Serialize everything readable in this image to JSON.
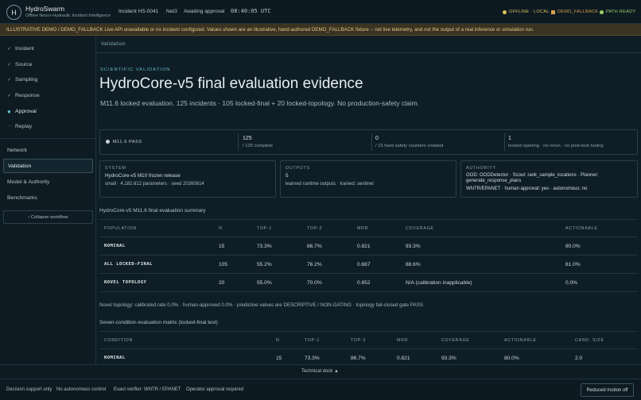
{
  "app": {
    "logo_letter": "H",
    "name": "HydroSwarm",
    "subtitle": "Offline Neuro-Hydraulic Incident Intelligence"
  },
  "topbar": {
    "incident": "Incident HS-0041",
    "network": "Net3",
    "state": "Awaiting approval",
    "clock": "08:40:05 UTC",
    "statuses": [
      {
        "label": "OFFLINE · LOCAL",
        "color": "#d9c25a"
      },
      {
        "label": "DEMO_FALLBACK",
        "color": "#d9a04a"
      },
      {
        "label": "PATH READY",
        "color": "#9fcf6a"
      }
    ]
  },
  "banner": "ILLUSTRATIVE DEMO / DEMO_FALLBACK  Live API unavailable or no incident configured. Values shown are an illustrative, hand-authored DEMO_FALLBACK fixture -- not live telemetry, and not the output of a real inference or simulation run.",
  "sidebar": {
    "workflow": [
      {
        "label": "Incident",
        "icon": "check-icon",
        "glyph": "✓"
      },
      {
        "label": "Source",
        "icon": "check-icon",
        "glyph": "✓"
      },
      {
        "label": "Sampling",
        "icon": "check-icon",
        "glyph": "✓"
      },
      {
        "label": "Response",
        "icon": "check-icon",
        "glyph": "✓"
      },
      {
        "label": "Approval",
        "icon": "current-dot-icon",
        "glyph": "●"
      },
      {
        "label": "Replay",
        "icon": "pending-dots-icon",
        "glyph": "···"
      }
    ],
    "nav": [
      "Network",
      "Validation",
      "Model & Authority",
      "Benchmarks"
    ],
    "active": "Validation",
    "collapse_label": "‹ Collapse workflow"
  },
  "main": {
    "breadcrumb": "Validation",
    "eyebrow": "SCIENTIFIC VALIDATION",
    "title": "HydroCore-v5 final evaluation evidence",
    "lead": "M11.6 locked evaluation. 125 incidents · 105 locked-final + 20 locked-topology. No production-safety claim.",
    "kpis": {
      "pass_label": "M11.6 PASS",
      "pass_color": "#c8d3d7",
      "items": [
        {
          "value": "125",
          "label": "/ 125 complete"
        },
        {
          "value": "0",
          "label": "/ 15 hard safety counters violated"
        },
        {
          "value": "1",
          "label": "locked opening · no rerun · no post-lock tuning"
        }
      ]
    },
    "cards": {
      "system": {
        "heading": "SYSTEM",
        "line1": "HydroCore-v5 M10 frozen release",
        "line2": "small · 4,182,612 parameters · seed 20260814"
      },
      "outputs": {
        "heading": "OUTPUTS",
        "line1": "5",
        "line2": "learned runtime outputs · trained: sentinel"
      },
      "authority": {
        "heading": "AUTHORITY",
        "line1": "OOD: OODDetector · Scout: rank_sample_locations · Planner:",
        "line1b": "generate_response_plans",
        "line2": "WNTR/EPANET · human approval: yes · autonomous: no"
      }
    },
    "summary": {
      "title": "HydroCore-v5 M11.6 final evaluation summary",
      "headers": [
        "POPULATION",
        "N",
        "TOP-1",
        "TOP-3",
        "MRR",
        "COVERAGE",
        "ACTIONABLE"
      ],
      "rows": [
        [
          "NOMINAL",
          "15",
          "73.3%",
          "86.7%",
          "0.821",
          "93.3%",
          "80.0%"
        ],
        [
          "ALL LOCKED-FINAL",
          "105",
          "55.2%",
          "76.2%",
          "0.687",
          "88.6%",
          "61.0%"
        ],
        [
          "NOVEL TOPOLOGY",
          "20",
          "55.0%",
          "70.0%",
          "0.652",
          "N/A (calibration inapplicable)",
          "0.0%"
        ]
      ]
    },
    "novel_note": "Novel topology: calibrated rate 0.0% · human-approved 0.0% · predictive values are DESCRIPTIVE / NON-GATING · topology fail-closed gate PASS",
    "matrix": {
      "title": "Seven-condition evaluation matrix (locked-final test)",
      "headers": [
        "CONDITION",
        "N",
        "TOP-1",
        "TOP-3",
        "MRR",
        "COVERAGE",
        "ACTIONABLE",
        "CAND. SIZE"
      ],
      "rows": [
        [
          "NOMINAL",
          "15",
          "73.3%",
          "86.7%",
          "0.821",
          "93.3%",
          "80.0%",
          "2.0"
        ]
      ]
    }
  },
  "dock": {
    "label": "Technical dock ▲"
  },
  "footer": {
    "items": [
      "Decision support only",
      "No autonomous control",
      "Exact verifier: WNTR / EPANET",
      "Operator approval required"
    ],
    "button": "Reduced motion off"
  }
}
